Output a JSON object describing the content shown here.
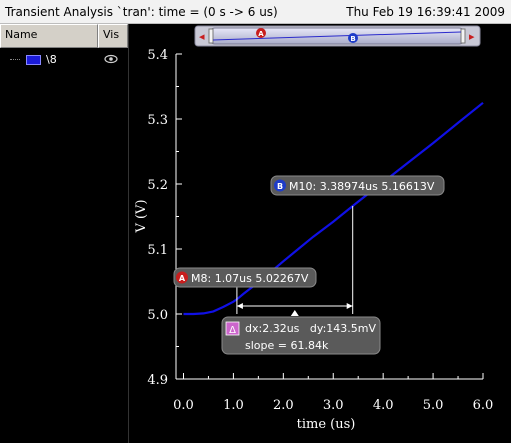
{
  "window": {
    "title": "Transient Analysis `tran': time = (0 s -> 6 us)",
    "datetime": "Thu Feb 19 16:39:41 2009"
  },
  "browser": {
    "columns": [
      "Name",
      "Vis"
    ],
    "signals": [
      {
        "name": "\\8",
        "color": "#1b1bd8",
        "visible_icon": "eye-icon"
      }
    ]
  },
  "colors": {
    "curve": "#1010e6",
    "background": "#000000",
    "marker_a": "#c81e1e",
    "marker_b": "#1e3cc8",
    "delta": "#cc66cc",
    "label_bg": "#5a5a5a"
  },
  "chart_data": {
    "type": "line",
    "title": "",
    "xlabel": "time (us)",
    "ylabel": "V (V)",
    "xlim": [
      -0.15,
      6.0
    ],
    "ylim": [
      4.9,
      5.4
    ],
    "xticks": [
      0.0,
      1.0,
      2.0,
      3.0,
      4.0,
      5.0,
      6.0
    ],
    "xtick_labels": [
      "0.0",
      "1.0",
      "2.0",
      "3.0",
      "4.0",
      "5.0",
      "6.0"
    ],
    "yticks": [
      4.9,
      5.0,
      5.1,
      5.2,
      5.3,
      5.4
    ],
    "ytick_labels": [
      "4.9",
      "5.0",
      "5.1",
      "5.2",
      "5.3",
      "5.4"
    ],
    "grid": false,
    "series": [
      {
        "name": "\\8",
        "x": [
          0.0,
          0.2,
          0.4,
          0.6,
          0.8,
          1.0,
          1.07,
          1.2,
          1.4,
          1.6,
          1.8,
          2.0,
          2.3,
          2.6,
          3.0,
          3.39,
          3.7,
          4.0,
          4.5,
          5.0,
          5.5,
          6.0
        ],
        "y": [
          5.0,
          5.0,
          5.001,
          5.004,
          5.011,
          5.019,
          5.02267,
          5.031,
          5.043,
          5.055,
          5.068,
          5.081,
          5.1,
          5.119,
          5.142,
          5.16613,
          5.185,
          5.203,
          5.233,
          5.263,
          5.294,
          5.325
        ]
      }
    ],
    "markers": [
      {
        "id": "A",
        "label": "M8: 1.07us 5.02267V",
        "x": 1.07,
        "y": 5.02267
      },
      {
        "id": "B",
        "label": "M10: 3.38974us 5.16613V",
        "x": 3.38974,
        "y": 5.16613
      }
    ],
    "delta": {
      "symbol": "Δ",
      "line1": "dx:2.32us   dy:143.5mV",
      "line2": "slope = 61.84k"
    },
    "zoom_bar": {
      "left_arrow": "◂",
      "right_arrow": "▸",
      "marker_a": "A",
      "marker_b": "B"
    }
  }
}
